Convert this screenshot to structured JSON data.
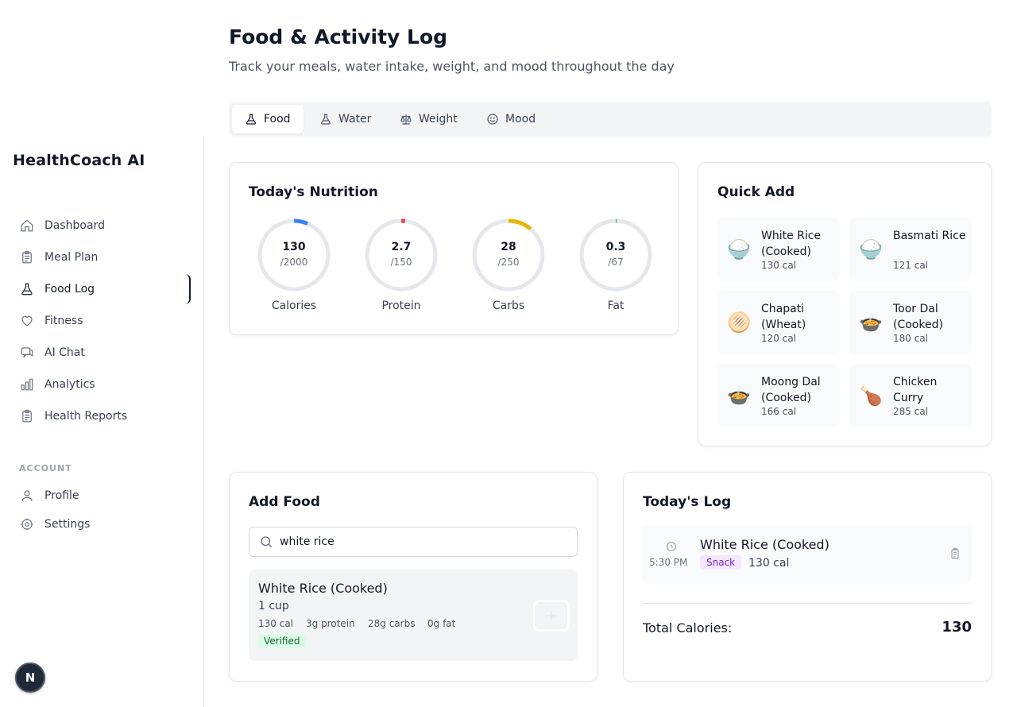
{
  "sidebar": {
    "brand": "HealthCoach AI",
    "items": [
      {
        "label": "Dashboard",
        "icon": "home-icon"
      },
      {
        "label": "Meal Plan",
        "icon": "clipboard-icon"
      },
      {
        "label": "Food Log",
        "icon": "flask-icon"
      },
      {
        "label": "Fitness",
        "icon": "heart-icon"
      },
      {
        "label": "AI Chat",
        "icon": "chat-icon"
      },
      {
        "label": "Analytics",
        "icon": "bar-chart-icon"
      },
      {
        "label": "Health Reports",
        "icon": "clipboard-icon"
      }
    ],
    "account_label": "ACCOUNT",
    "account_items": [
      {
        "label": "Profile",
        "icon": "user-icon"
      },
      {
        "label": "Settings",
        "icon": "gear-icon"
      }
    ],
    "badge": "N"
  },
  "header": {
    "title": "Food & Activity Log",
    "subtitle": "Track your meals, water intake, weight, and mood throughout the day"
  },
  "tabs": [
    {
      "label": "Food",
      "icon": "flask-icon",
      "active": true
    },
    {
      "label": "Water",
      "icon": "flask-icon",
      "active": false
    },
    {
      "label": "Weight",
      "icon": "scale-icon",
      "active": false
    },
    {
      "label": "Mood",
      "icon": "smile-icon",
      "active": false
    }
  ],
  "nutrition": {
    "title": "Today's Nutrition",
    "items": [
      {
        "label": "Calories",
        "value": "130",
        "goal": "/2000",
        "current": 130,
        "target": 2000,
        "color": "#3b82f6"
      },
      {
        "label": "Protein",
        "value": "2.7",
        "goal": "/150",
        "current": 2.7,
        "target": 150,
        "color": "#ef4444"
      },
      {
        "label": "Carbs",
        "value": "28",
        "goal": "/250",
        "current": 28,
        "target": 250,
        "color": "#eab308"
      },
      {
        "label": "Fat",
        "value": "0.3",
        "goal": "/67",
        "current": 0.3,
        "target": 67,
        "color": "#22c55e"
      }
    ]
  },
  "quick_add": {
    "title": "Quick Add",
    "items": [
      {
        "emoji": "🍚",
        "name": "White Rice (Cooked)",
        "cal": "130 cal"
      },
      {
        "emoji": "🍚",
        "name": "Basmati Rice",
        "cal": "121 cal"
      },
      {
        "emoji": "🫓",
        "name": "Chapati (Wheat)",
        "cal": "120 cal"
      },
      {
        "emoji": "🍲",
        "name": "Toor Dal (Cooked)",
        "cal": "180 cal"
      },
      {
        "emoji": "🍲",
        "name": "Moong Dal (Cooked)",
        "cal": "166 cal"
      },
      {
        "emoji": "🍗",
        "name": "Chicken Curry",
        "cal": "285 cal"
      }
    ]
  },
  "add_food": {
    "title": "Add Food",
    "search_value": "white rice",
    "result": {
      "name": "White Rice (Cooked)",
      "serving": "1 cup",
      "cal": "130 cal",
      "protein": "3g protein",
      "carbs": "28g carbs",
      "fat": "0g fat",
      "badge": "Verified",
      "add_label": "+"
    }
  },
  "todays_log": {
    "title": "Today's Log",
    "entries": [
      {
        "time": "5:30 PM",
        "name": "White Rice (Cooked)",
        "tag": "Snack",
        "cal": "130 cal"
      }
    ],
    "total_label": "Total Calories:",
    "total_value": "130"
  }
}
